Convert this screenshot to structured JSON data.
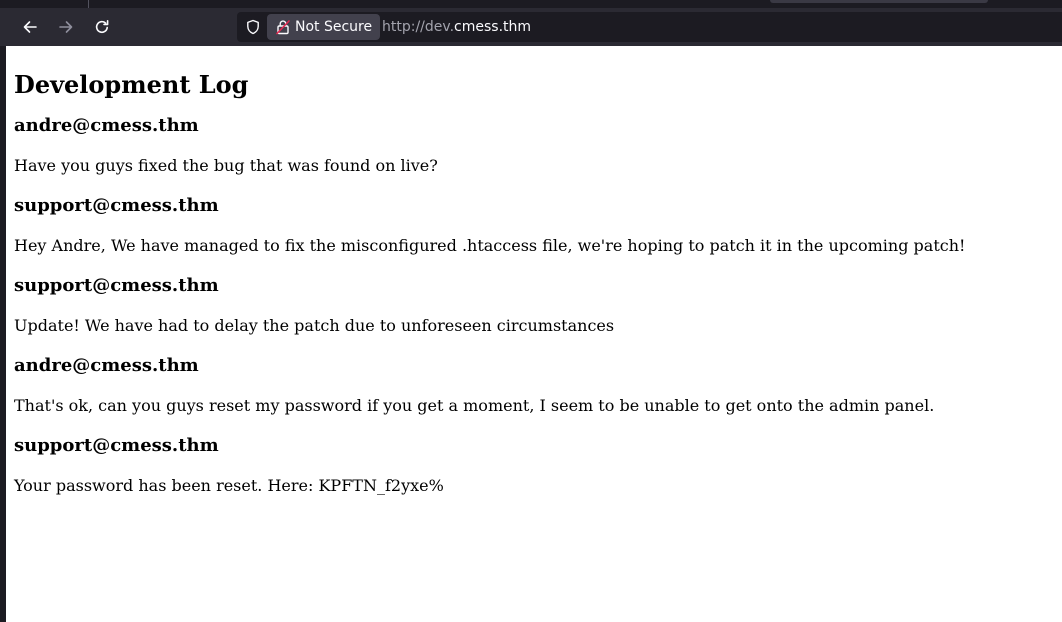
{
  "browser": {
    "security_label": "Not Secure",
    "url_scheme": "http://dev.",
    "url_host": "cmess.thm",
    "icons": {
      "back": "arrow-left-icon",
      "forward": "arrow-right-icon",
      "reload": "reload-icon",
      "tracking": "shield-icon",
      "insecure": "insecure-lock-icon"
    },
    "colors": {
      "toolbar": "#2b2a33",
      "urlbar": "#1c1b22",
      "insecure_accent": "#e22850"
    }
  },
  "page": {
    "title": "Development Log",
    "entries": [
      {
        "author": "andre@cmess.thm",
        "message": "Have you guys fixed the bug that was found on live?"
      },
      {
        "author": "support@cmess.thm",
        "message": "Hey Andre, We have managed to fix the misconfigured .htaccess file, we're hoping to patch it in the upcoming patch!"
      },
      {
        "author": "support@cmess.thm",
        "message": "Update! We have had to delay the patch due to unforeseen circumstances"
      },
      {
        "author": "andre@cmess.thm",
        "message": "That's ok, can you guys reset my password if you get a moment, I seem to be unable to get onto the admin panel."
      },
      {
        "author": "support@cmess.thm",
        "message": "Your password has been reset. Here: KPFTN_f2yxe%"
      }
    ]
  }
}
